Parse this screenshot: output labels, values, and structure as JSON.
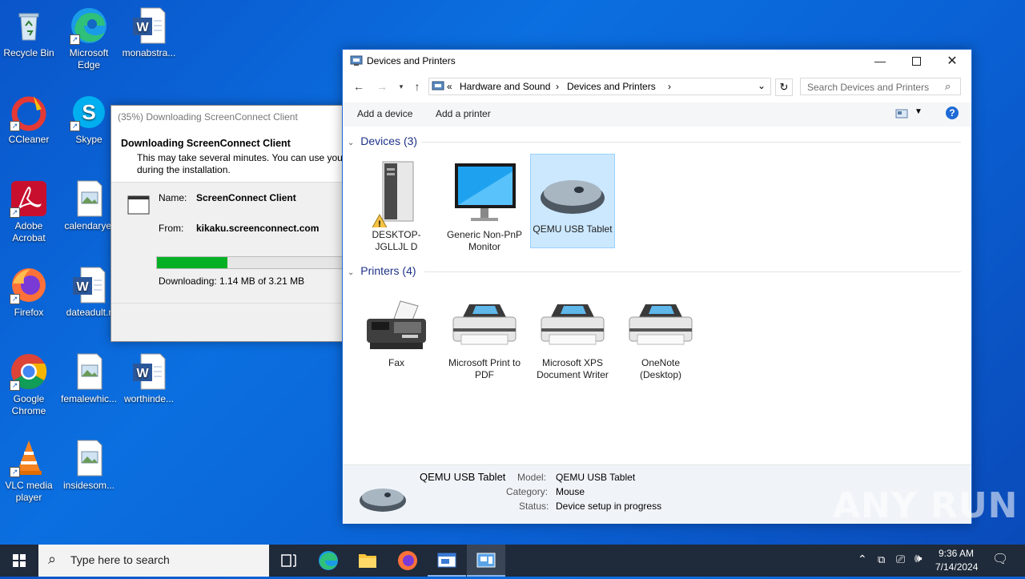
{
  "desktop": {
    "icons": [
      {
        "label": "Recycle Bin"
      },
      {
        "label": "Microsoft Edge"
      },
      {
        "label": "monabstra..."
      },
      {
        "label": "CCleaner"
      },
      {
        "label": "Skype"
      },
      {
        "label": "Adobe Acrobat"
      },
      {
        "label": "calendaryel"
      },
      {
        "label": "Firefox"
      },
      {
        "label": "dateadult.r"
      },
      {
        "label": "Google Chrome"
      },
      {
        "label": "femalewhic..."
      },
      {
        "label": "worthinde..."
      },
      {
        "label": "VLC media player"
      },
      {
        "label": "insidesom..."
      }
    ]
  },
  "download_dialog": {
    "title": "(35%) Downloading ScreenConnect Client",
    "heading": "Downloading ScreenConnect Client",
    "description_line1": "This may take several minutes. You can use your",
    "description_line2": "during the installation.",
    "name_label": "Name:",
    "name_value": "ScreenConnect Client",
    "from_label": "From:",
    "from_value": "kikaku.screenconnect.com",
    "progress_fraction": 0.35,
    "status": "Downloading: 1.14 MB of 3.21 MB"
  },
  "window": {
    "title": "Devices and Printers",
    "breadcrumb": [
      "«",
      "Hardware and Sound",
      "›",
      "Devices and Printers",
      "›"
    ],
    "search_placeholder": "Search Devices and Printers",
    "commands": {
      "add_device": "Add a device",
      "add_printer": "Add a printer"
    },
    "devices_group": "Devices (3)",
    "devices": [
      {
        "label": "DESKTOP-JGLLJL D",
        "icon": "computer-tower-icon"
      },
      {
        "label": "Generic Non-PnP Monitor",
        "icon": "monitor-icon"
      },
      {
        "label": "QEMU USB Tablet",
        "icon": "mouse-icon"
      }
    ],
    "printers_group": "Printers (4)",
    "printers": [
      {
        "label": "Fax",
        "icon": "fax-icon"
      },
      {
        "label": "Microsoft Print to PDF",
        "icon": "printer-icon"
      },
      {
        "label": "Microsoft XPS Document Writer",
        "icon": "printer-icon"
      },
      {
        "label": "OneNote (Desktop)",
        "icon": "printer-icon"
      }
    ],
    "details": {
      "name": "QEMU USB Tablet",
      "model_label": "Model:",
      "model_value": "QEMU USB Tablet",
      "category_label": "Category:",
      "category_value": "Mouse",
      "status_label": "Status:",
      "status_value": "Device setup in progress"
    }
  },
  "taskbar": {
    "search_placeholder": "Type here to search",
    "time": "9:36 AM",
    "date": "7/14/2024"
  },
  "watermark": "ANY RUN",
  "colors": {
    "accent": "#0078d7",
    "progress": "#06b025",
    "selection": "#cce8ff"
  }
}
